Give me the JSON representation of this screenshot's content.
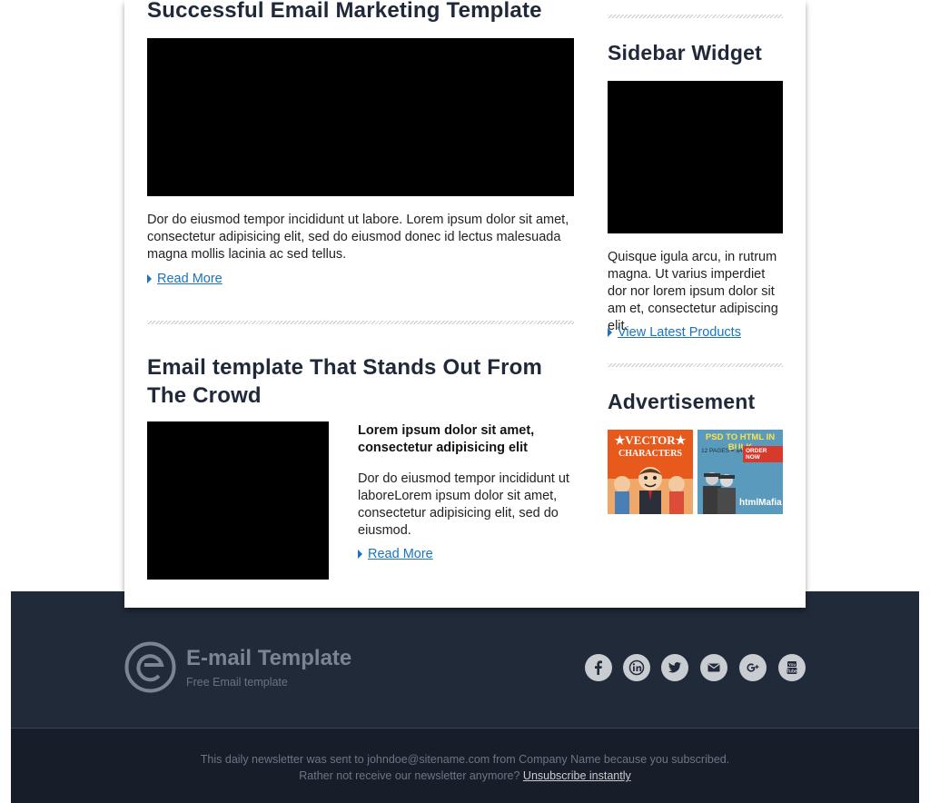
{
  "articles": [
    {
      "title": "Successful Email Marketing Template",
      "body": "Dor do eiusmod tempor incididunt ut labore. Lorem ipsum dolor sit amet, consectetur adipisicing elit, sed do eiusmod donec id lectus malesuada magna mollis lacinia ac sed tellus.",
      "link_label": "Read More"
    },
    {
      "title": "Email template That Stands Out From The Crowd",
      "lead": "Lorem ipsum dolor sit amet, consectetur adipisicing elit",
      "body": "Dor do eiusmod tempor incididunt ut laboreLorem ipsum dolor sit amet, consectetur adipisicing elit, sed do eiusmod.",
      "link_label": "Read More"
    }
  ],
  "sidebar": {
    "widget_title": "Sidebar Widget",
    "widget_body": "Quisque igula arcu, in rutrum magna. Ut varius imperdiet dor nor lorem ipsum dolor sit am et, consectetur adipiscing elit.",
    "widget_link": "View Latest Products",
    "ad_title": "Advertisement",
    "ads": [
      {
        "line1": "★VECTOR★",
        "line2": "CHARACTERS"
      },
      {
        "line1": "PSD TO HTML IN BULK",
        "line2": "12 PAGES = $480",
        "button": "ORDER NOW",
        "brand": "htmlMafia"
      }
    ]
  },
  "footer": {
    "brand_name": "E-mail Template",
    "tagline": "Free Email template",
    "social": [
      "facebook-icon",
      "linkedin-icon",
      "twitter-icon",
      "email-icon",
      "google-plus-icon",
      "youtube-icon"
    ],
    "legal_line1": "This daily newsletter was sent to johndoe@sitename.com from Company Name because you subscribed.",
    "legal_line2": "Rather not receive our newsletter anymore?",
    "unsubscribe_label": "Unsubscribe instantly"
  },
  "colors": {
    "heading": "#20293a",
    "link": "#1a73c0",
    "footer_bg": "#212a39",
    "legal_bg": "#171e29"
  }
}
